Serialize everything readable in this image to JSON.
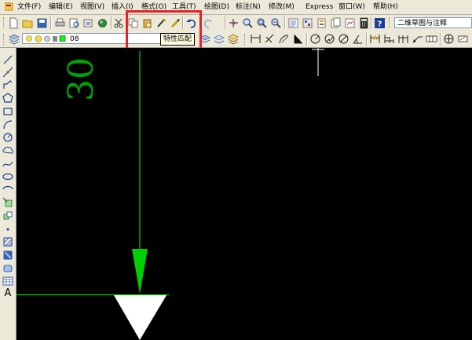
{
  "menu": {
    "items": [
      "文件(F)",
      "编辑(E)",
      "视图(V)",
      "插入(I)",
      "格式(O)",
      "工具(T)",
      "绘图(D)",
      "标注(N)",
      "修改(M)",
      "Express",
      "窗口(W)",
      "帮助(H)"
    ]
  },
  "toolbar": {
    "workspace": "二维草图与注释",
    "tooltip": "特性匹配"
  },
  "layers": {
    "current_layer": "08"
  },
  "left_toolbar": {
    "text_tool": "A"
  },
  "drawing": {
    "handwritten_text": "30",
    "colors": {
      "canvas": "#000000",
      "arrow": "#00d000",
      "line": "#00ff00",
      "triangle": "#ffffff",
      "cursor": "#ffffff",
      "highlight": "#e8202a"
    }
  }
}
